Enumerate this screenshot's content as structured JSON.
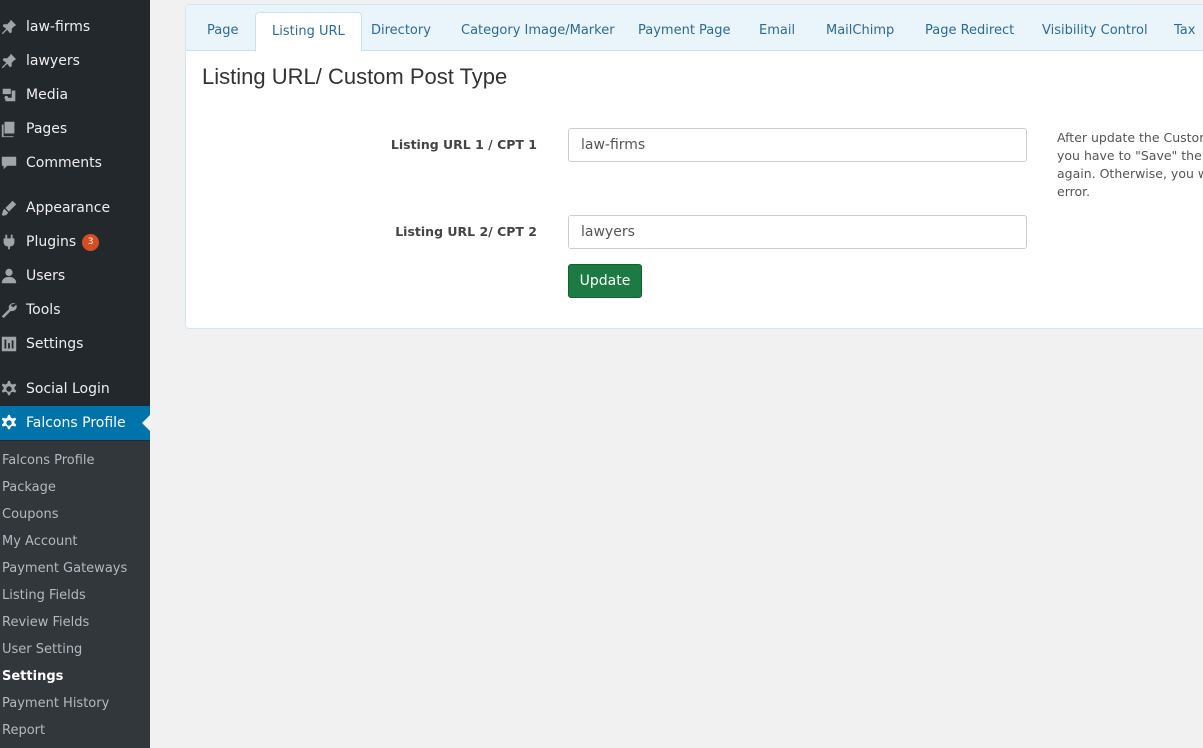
{
  "sidebar": {
    "items": [
      {
        "label": "law-firms",
        "icon": "pin-icon"
      },
      {
        "label": "lawyers",
        "icon": "pin-icon"
      },
      {
        "label": "Media",
        "icon": "media-icon"
      },
      {
        "label": "Pages",
        "icon": "pages-icon"
      },
      {
        "label": "Comments",
        "icon": "comments-icon"
      },
      {
        "label": "Appearance",
        "icon": "brush-icon"
      },
      {
        "label": "Plugins",
        "icon": "plugin-icon",
        "badge": "3"
      },
      {
        "label": "Users",
        "icon": "user-icon"
      },
      {
        "label": "Tools",
        "icon": "wrench-icon"
      },
      {
        "label": "Settings",
        "icon": "settings-icon"
      },
      {
        "label": "Social Login",
        "icon": "gear-icon"
      },
      {
        "label": "Falcons Profile",
        "icon": "gear-icon"
      }
    ],
    "submenu": [
      "Falcons Profile",
      "Package",
      "Coupons",
      "My Account",
      "Payment Gateways",
      "Listing Fields",
      "Review Fields",
      "User Setting",
      "Settings",
      "Payment History",
      "Report"
    ]
  },
  "tabs": [
    "Page",
    "Listing URL",
    "Directory",
    "Category Image/Marker",
    "Payment Page",
    "Email",
    "MailChimp",
    "Page Redirect",
    "Visibility Control",
    "Tax"
  ],
  "main": {
    "title": "Listing URL/ Custom Post Type",
    "field1_label": "Listing URL 1 / CPT 1",
    "field1_value": "law-firms",
    "field2_label": "Listing URL 2/ CPT 2",
    "field2_value": "lawyers",
    "update_label": "Update",
    "help_lines": [
      "After update the Custom",
      "you have to \"Save\" the p",
      "again. Otherwise, you wi",
      "error."
    ]
  },
  "colors": {
    "sidebar_bg": "#23282d",
    "submenu_bg": "#32373c",
    "active_menu": "#0073aa",
    "update_button": "#1c7a43",
    "plugin_badge": "#d54e21"
  }
}
